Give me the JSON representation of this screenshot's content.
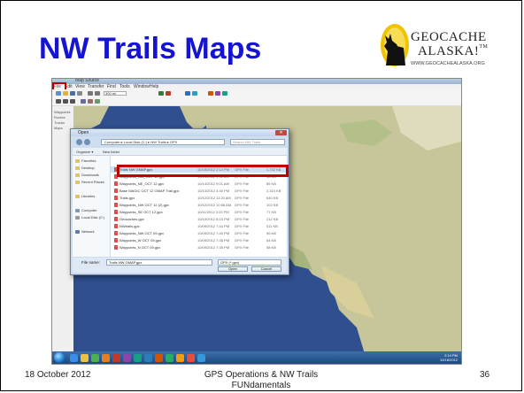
{
  "slide": {
    "title": "NW Trails Maps",
    "footer_date": "18 October 2012",
    "footer_title": "GPS Operations & NW Trails FUNdamentals",
    "page_number": "36"
  },
  "logo": {
    "line1": "GEOCACHE",
    "line2": "ALASKA!",
    "url": "WWW.GEOCACHEALASKA.ORG"
  },
  "app": {
    "title": "Map Source",
    "menu": [
      "File",
      "Edit",
      "View",
      "Transfer",
      "Find",
      "Tools",
      "Window",
      "Help"
    ],
    "zoom_value": "300 mi",
    "left_panel_items": [
      "Waypoints",
      "Routes",
      "Tracks",
      "Maps"
    ]
  },
  "dialog": {
    "title": "Open",
    "search_placeholder": "Search NW Trails",
    "address_path": "Computer ▸ Local Disk (C:) ▸ NW Trails ▸ GPX",
    "commands": [
      "Organize ▾",
      "New folder"
    ],
    "sidebar": [
      "Favorites",
      "Desktop",
      "Downloads",
      "Recent Places",
      "Libraries",
      "Computer",
      "Local Disk (C:)",
      "Network"
    ],
    "files": [
      {
        "name": "Trails NW GMAP.gpx",
        "date": "10/15/2012 2:14 PM",
        "type": "GPX File",
        "size": "1,742 KB"
      },
      {
        "name": "Waypoints_NW_OCT 12.gpx",
        "date": "10/14/2012 9:02 AM",
        "type": "GPX File",
        "size": "98 KB"
      },
      {
        "name": "Waypoints_NE_OCT 12.gpx",
        "date": "10/14/2012 9:01 AM",
        "type": "GPX File",
        "size": "85 KB"
      },
      {
        "name": "Base MAGIC OCT 12 GMAP Trail.gpx",
        "date": "10/13/2012 4:40 PM",
        "type": "GPX File",
        "size": "2,310 KB"
      },
      {
        "name": "Trails.gpx",
        "date": "10/12/2012 11:20 AM",
        "type": "GPX File",
        "size": "640 KB"
      },
      {
        "name": "Waypoints_NW OCT 12 (2).gpx",
        "date": "10/12/2012 10:58 AM",
        "type": "GPX File",
        "size": "102 KB"
      },
      {
        "name": "Waypoints_SE OCT 12.gpx",
        "date": "10/11/2012 3:33 PM",
        "type": "GPX File",
        "size": "77 KB"
      },
      {
        "name": "Geocaches.gpx",
        "date": "10/10/2012 8:15 PM",
        "type": "GPX File",
        "size": "212 KB"
      },
      {
        "name": "NWtrails.gpx",
        "date": "10/09/2012 7:44 PM",
        "type": "GPX File",
        "size": "511 KB"
      },
      {
        "name": "Waypoints_NW OCT 09.gpx",
        "date": "10/09/2012 7:40 PM",
        "type": "GPX File",
        "size": "96 KB"
      },
      {
        "name": "Waypoints_W OCT 09.gpx",
        "date": "10/09/2012 7:38 PM",
        "type": "GPX File",
        "size": "64 KB"
      },
      {
        "name": "Waypoints_N OCT 09.gpx",
        "date": "10/09/2012 7:35 PM",
        "type": "GPX File",
        "size": "58 KB"
      }
    ],
    "filename_label": "File name:",
    "filename_value": "Trails NW GMAP.gpx",
    "filetype_value": "GPX (*.gpx)",
    "open_label": "Open",
    "cancel_label": "Cancel"
  },
  "taskbar": {
    "clock_time": "2:14 PM",
    "clock_date": "10/18/2012"
  },
  "colors": {
    "title_blue": "#1414d2",
    "highlight_red": "#c00000",
    "ocean": "#2f4f8f",
    "land": "#c7c59a"
  }
}
